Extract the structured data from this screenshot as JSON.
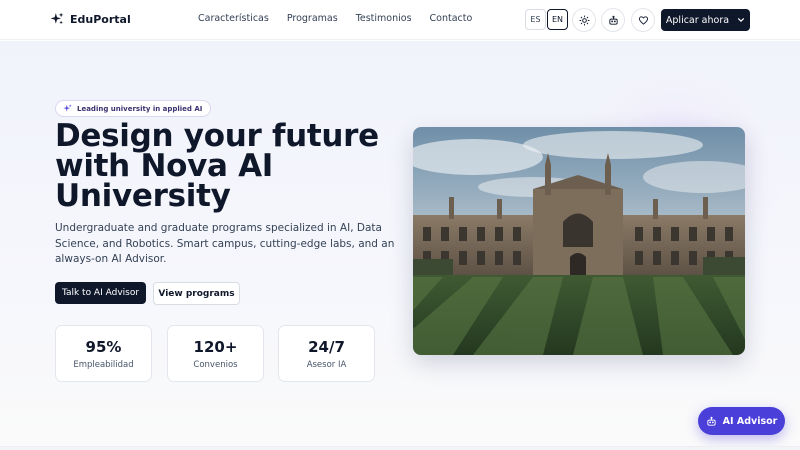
{
  "brand": {
    "name": "EduPortal",
    "icon": "sparkle-icon"
  },
  "nav": [
    "Características",
    "Programas",
    "Testimonios",
    "Contacto"
  ],
  "languages": [
    {
      "code": "ES",
      "active": false
    },
    {
      "code": "EN",
      "active": true
    }
  ],
  "header_actions": {
    "theme_icon": "sun-icon",
    "robot_icon": "robot-icon",
    "favorite_icon": "heart-icon",
    "apply_label": "Aplicar ahora"
  },
  "hero": {
    "badge": "Leading university in applied AI",
    "title": "Design your future with Nova AI University",
    "description": "Undergraduate and graduate programs specialized in AI, Data Science, and Robotics. Smart campus, cutting-edge labs, and an always-on AI Advisor.",
    "primary_cta": "Talk to AI Advisor",
    "secondary_cta": "View programs"
  },
  "stats": [
    {
      "value": "95%",
      "label": "Empleabilidad"
    },
    {
      "value": "120+",
      "label": "Convenios"
    },
    {
      "value": "24/7",
      "label": "Asesor IA"
    }
  ],
  "floating_button": {
    "label": "AI Advisor",
    "icon": "robot-icon"
  },
  "colors": {
    "dark": "#0f172a",
    "accent": "#4b3fd9",
    "background": "#f1f3fb"
  }
}
